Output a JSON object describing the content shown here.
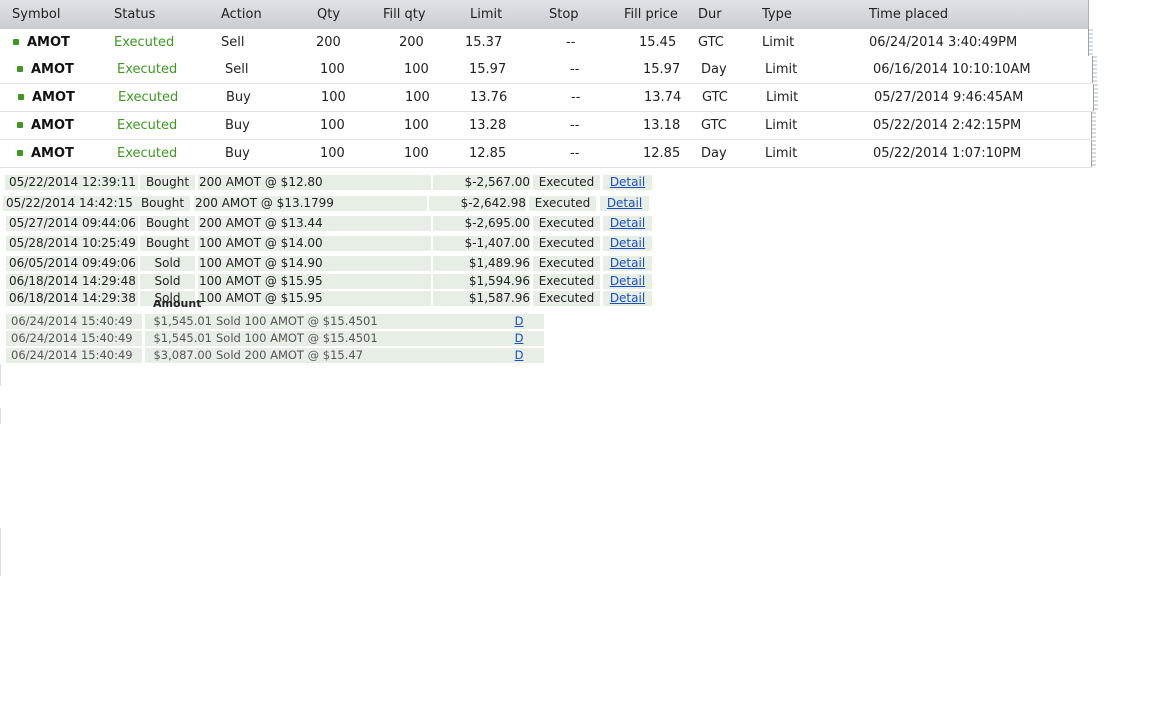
{
  "orders": {
    "headers": {
      "symbol": "Symbol",
      "status": "Status",
      "action": "Action",
      "qty": "Qty",
      "fill_qty": "Fill qty",
      "limit": "Limit",
      "stop": "Stop",
      "fill_price": "Fill price",
      "dur": "Dur",
      "type": "Type",
      "time_placed": "Time placed"
    },
    "rows": [
      {
        "symbol": "AMOT",
        "status": "Executed",
        "action": "Sell",
        "qty": "200",
        "fill_qty": "200",
        "limit": "15.37",
        "stop": "--",
        "fill_price": "15.45",
        "dur": "GTC",
        "type": "Limit",
        "time": "06/24/2014 3:40:49PM"
      },
      {
        "symbol": "AMOT",
        "status": "Executed",
        "action": "Sell",
        "qty": "100",
        "fill_qty": "100",
        "limit": "15.97",
        "stop": "--",
        "fill_price": "15.97",
        "dur": "Day",
        "type": "Limit",
        "time": "06/16/2014 10:10:10AM"
      },
      {
        "symbol": "AMOT",
        "status": "Executed",
        "action": "Buy",
        "qty": "100",
        "fill_qty": "100",
        "limit": "13.76",
        "stop": "--",
        "fill_price": "13.74",
        "dur": "GTC",
        "type": "Limit",
        "time": "05/27/2014 9:46:45AM"
      },
      {
        "symbol": "AMOT",
        "status": "Executed",
        "action": "Buy",
        "qty": "100",
        "fill_qty": "100",
        "limit": "13.28",
        "stop": "--",
        "fill_price": "13.18",
        "dur": "GTC",
        "type": "Limit",
        "time": "05/22/2014 2:42:15PM"
      },
      {
        "symbol": "AMOT",
        "status": "Executed",
        "action": "Buy",
        "qty": "100",
        "fill_qty": "100",
        "limit": "12.85",
        "stop": "--",
        "fill_price": "12.85",
        "dur": "Day",
        "type": "Limit",
        "time": "05/22/2014 1:07:10PM"
      }
    ],
    "status_color": "#3c9a20"
  },
  "transactions": {
    "rows": [
      {
        "datetime": "05/22/2014 12:39:11",
        "type": "Bought",
        "desc": "200 AMOT @ $12.80",
        "amount": "$-2,567.00",
        "status": "Executed",
        "link": "Detail"
      },
      {
        "datetime": "05/22/2014 14:42:15",
        "type": "Bought",
        "desc": "200 AMOT @ $13.1799",
        "amount": "$-2,642.98",
        "status": "Executed",
        "link": "Detail"
      },
      {
        "datetime": "05/27/2014 09:44:06",
        "type": "Bought",
        "desc": "200 AMOT @ $13.44",
        "amount": "$-2,695.00",
        "status": "Executed",
        "link": "Detail"
      },
      {
        "datetime": "05/28/2014 10:25:49",
        "type": "Bought",
        "desc": "100 AMOT @ $14.00",
        "amount": "$-1,407.00",
        "status": "Executed",
        "link": "Detail"
      },
      {
        "datetime": "06/05/2014 09:49:06",
        "type": "Sold",
        "desc": "100 AMOT @ $14.90",
        "amount": "$1,489.96",
        "status": "Executed",
        "link": "Detail"
      },
      {
        "datetime": "06/18/2014 14:29:48",
        "type": "Sold",
        "desc": "100 AMOT @ $15.95",
        "amount": "$1,594.96",
        "status": "Executed",
        "link": "Detail"
      },
      {
        "datetime": "06/18/2014 14:29:38",
        "type": "Sold",
        "desc": "100 AMOT @ $15.95",
        "amount": "$1,587.96",
        "status": "Executed",
        "link": "Detail"
      }
    ],
    "row_color": "#e6eee6",
    "link_color": "#1a4ec0"
  },
  "activity": {
    "hidden_header": "Amount",
    "rows": [
      {
        "datetime": "06/24/2014 15:40:49",
        "amount": "$1,545.01",
        "desc": "Sold 100 AMOT @ $15.4501",
        "link": "D"
      },
      {
        "datetime": "06/24/2014 15:40:49",
        "amount": "$1,545.01",
        "desc": "Sold 100 AMOT @ $15.4501",
        "link": "D"
      },
      {
        "datetime": "06/24/2014 15:40:49",
        "amount": "$3,087.00",
        "desc": "Sold 200 AMOT @ $15.47",
        "link": "D"
      }
    ]
  }
}
